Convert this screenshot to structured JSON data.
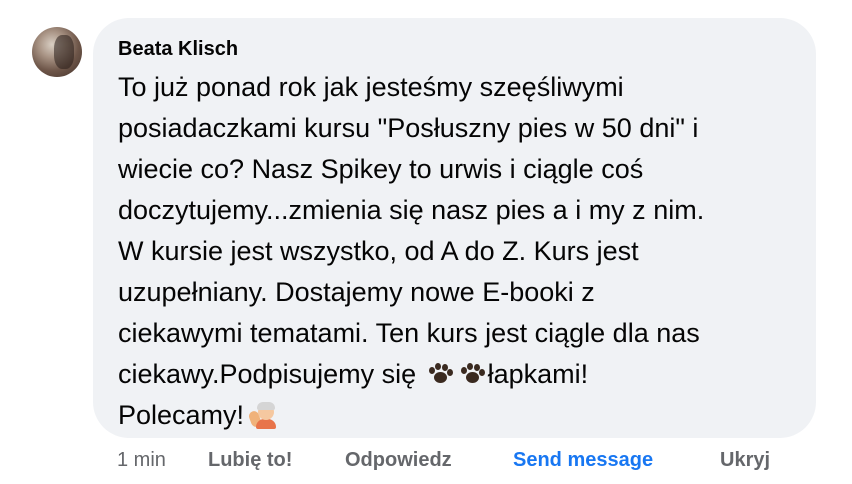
{
  "comment": {
    "author": "Beata Klisch",
    "lines": [
      "To już ponad rok jak jesteśmy szeęśliwymi",
      "posiadaczkami kursu \"Posłuszny pies w 50 dni\" i",
      "wiecie co? Nasz Spikey to urwis i ciągle coś",
      "doczytujemy...zmienia się nasz pies a i my z nim.",
      "W kursie jest wszystko, od A do Z. Kurs jest",
      "uzupełniany. Dostajemy nowe E-booki z",
      "ciekawymi tematami. Ten kurs jest ciągle dla nas"
    ],
    "line8_before": "ciekawy.Podpisujemy się ",
    "line8_after": "łapkami!",
    "line9": "Polecamy!",
    "icons": {
      "avatar": "user-avatar",
      "paw": "paw-prints-icon",
      "wave": "waving-person-icon"
    }
  },
  "actions": {
    "time": "1 min",
    "like": "Lubię to!",
    "reply": "Odpowiedz",
    "send": "Send message",
    "hide": "Ukryj"
  },
  "colors": {
    "bubble": "#f0f2f5",
    "text": "#050505",
    "muted": "#65676b",
    "link": "#1877f2"
  }
}
